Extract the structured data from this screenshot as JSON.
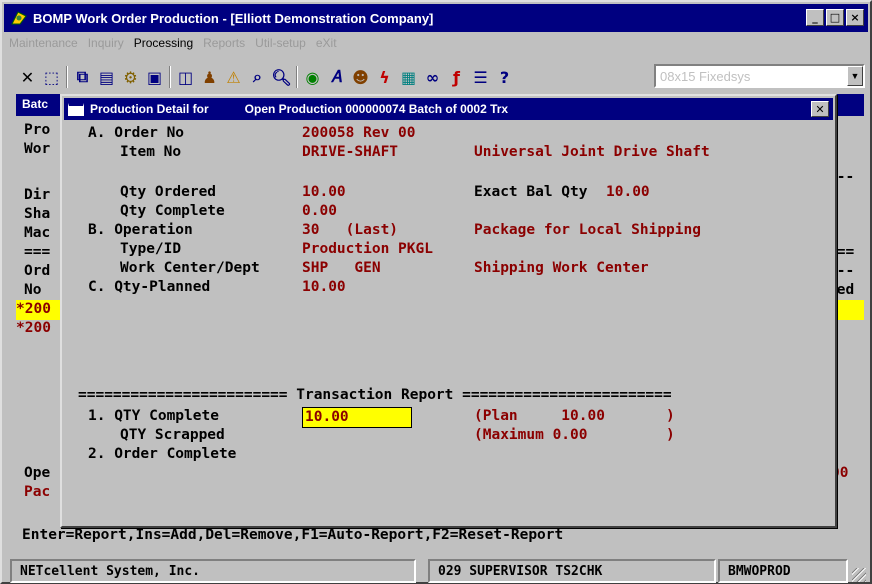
{
  "window": {
    "title": "BOMP Work Order Production - [Elliott Demonstration Company]",
    "buttons": {
      "minimize": "_",
      "maximize": "□",
      "close": "×"
    }
  },
  "menu": [
    "Maintenance",
    "Inquiry",
    "Processing",
    "Reports",
    "Util-setup",
    "eXit"
  ],
  "toolbar": {
    "icons": [
      "close-icon",
      "select-icon",
      "copy-icon",
      "paste-icon",
      "settings-icon",
      "properties-icon",
      "frame-icon",
      "users-icon",
      "warning-icon",
      "find-icon",
      "search-icon",
      "globe-icon",
      "text-icon",
      "people-icon",
      "lightning-icon",
      "chart-icon",
      "link-icon",
      "function-icon",
      "list-icon",
      "help-icon"
    ],
    "font_select": "08x15 Fixedsys"
  },
  "console": {
    "header": "Batc",
    "left_lines": [
      "Pro",
      "Wor",
      "",
      "Dir",
      "Sha",
      "Mac",
      "===",
      "Ord",
      "No",
      "*200",
      "*200"
    ],
    "right_lines": [
      "",
      "",
      "y--",
      "",
      "",
      "",
      "===",
      "---",
      "ped"
    ],
    "bottom_left": [
      "Ope",
      "Pac"
    ],
    "bottom_right": "00",
    "key_help": "Enter=Report,Ins=Add,Del=Remove,F1=Auto-Report,F2=Reset-Report"
  },
  "dialog": {
    "title_prefix": "Production Detail for",
    "title_batch": "Open Production 000000074 Batch of 0002 Trx",
    "order_no_label": "A. Order No",
    "order_no": "200058 Rev 00",
    "item_no_label": "Item No",
    "item_no": "DRIVE-SHAFT",
    "item_desc": "Universal Joint Drive Shaft",
    "qty_ordered_label": "Qty Ordered",
    "qty_ordered": "10.00",
    "exact_bal_label": "Exact Bal Qty",
    "exact_bal": "10.00",
    "qty_complete_label": "Qty Complete",
    "qty_complete": "0.00",
    "operation_label": "B. Operation",
    "operation": "30   (Last)",
    "operation_desc": "Package for Local Shipping",
    "type_id_label": "Type/ID",
    "type_id": "Production PKGL",
    "work_center_label": "Work Center/Dept",
    "work_center": "SHP   GEN",
    "work_center_desc": "Shipping Work Center",
    "qty_planned_label": "C. Qty-Planned",
    "qty_planned": "10.00",
    "transaction_header": "======================== Transaction Report ========================",
    "tr_qty_complete_label": "1. QTY Complete",
    "tr_qty_complete_value": "10.00",
    "tr_plan": "(Plan     10.00       )",
    "tr_qty_scrapped_label": "QTY Scrapped",
    "tr_maximum": "(Maximum 0.00         )",
    "tr_order_complete_label": "2. Order Complete"
  },
  "status": {
    "company": "NETcellent System, Inc.",
    "session": "029 SUPERVISOR TS2CHK",
    "program": "BMWOPROD"
  }
}
